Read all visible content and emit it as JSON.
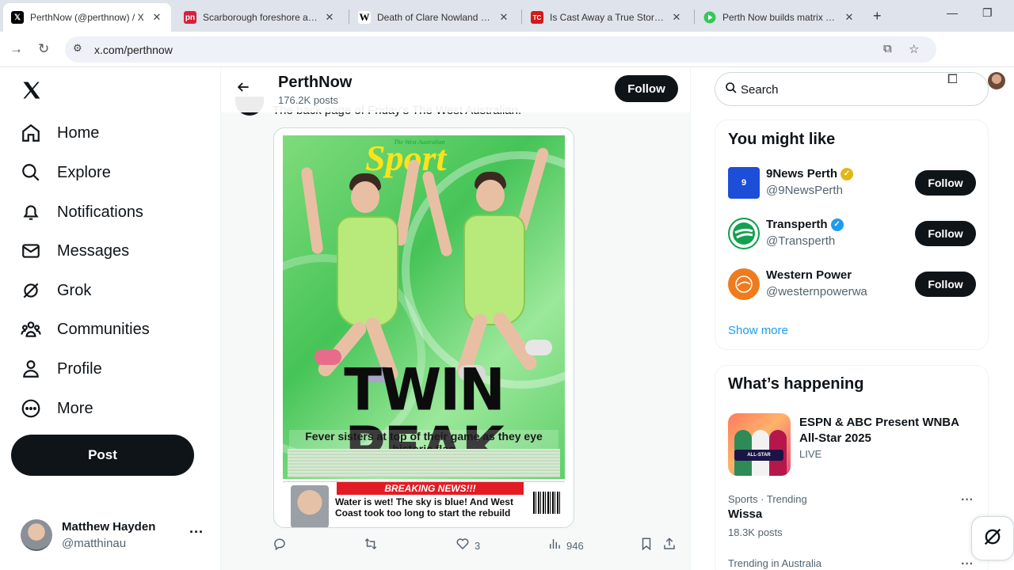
{
  "browser": {
    "tabs": [
      {
        "title": "PerthNow (@perthnow) / X",
        "icon": "x-logo-icon",
        "active": true
      },
      {
        "title": "Scarborough foreshore arrest",
        "icon": "pn-icon",
        "favicon_text": "pn",
        "active": false
      },
      {
        "title": "Death of Clare Nowland - Wikipedia",
        "icon": "wikipedia-icon",
        "favicon_text": "W",
        "active": false
      },
      {
        "title": "Is Cast Away a True Story? Is",
        "icon": "tc-icon",
        "favicon_text": "TC",
        "active": false
      },
      {
        "title": "Perth Now builds matrix with",
        "icon": "play-icon",
        "active": false
      }
    ],
    "url": "x.com/perthnow"
  },
  "sidebar": {
    "items": [
      {
        "label": "Home",
        "icon": "home-icon"
      },
      {
        "label": "Explore",
        "icon": "search-icon"
      },
      {
        "label": "Notifications",
        "icon": "bell-icon"
      },
      {
        "label": "Messages",
        "icon": "mail-icon"
      },
      {
        "label": "Grok",
        "icon": "grok-icon"
      },
      {
        "label": "Communities",
        "icon": "communities-icon"
      },
      {
        "label": "Profile",
        "icon": "person-icon"
      },
      {
        "label": "More",
        "icon": "more-circle-icon"
      }
    ],
    "post_label": "Post",
    "user": {
      "name": "Matthew Hayden",
      "handle": "@matthinau"
    }
  },
  "profile_header": {
    "name": "PerthNow",
    "posts": "176.2K posts",
    "follow_label": "Follow"
  },
  "tweet": {
    "text": "The back page of Friday's The West Australian.",
    "cover": {
      "paper": "The West Australian",
      "section": "Sport",
      "headline": "TWIN PEAK",
      "subhead": "Fever sisters at top of their game as they eye historic flag",
      "breaking_banner": "BREAKING NEWS!!!",
      "breaking_text": "Water is wet! The sky is blue! And West Coast took too long to start the rebuild"
    },
    "actions": {
      "reply": "",
      "retweet": "",
      "likes": "3",
      "views": "946"
    }
  },
  "right": {
    "search_placeholder": "Search",
    "you_might_like": {
      "title": "You might like",
      "accounts": [
        {
          "name": "9News Perth",
          "handle": "@9NewsPerth",
          "badge": "gold",
          "follow": "Follow"
        },
        {
          "name": "Transperth",
          "handle": "@Transperth",
          "badge": "blue",
          "follow": "Follow"
        },
        {
          "name": "Western Power",
          "handle": "@westernpowerwa",
          "badge": "",
          "follow": "Follow"
        }
      ],
      "show_more": "Show more"
    },
    "whats_happening": {
      "title": "What’s happening",
      "featured": {
        "title": "ESPN & ABC Present WNBA All-Star 2025",
        "status": "LIVE"
      },
      "trends": [
        {
          "meta": "Sports · Trending",
          "name": "Wissa",
          "posts": "18.3K posts"
        },
        {
          "meta": "Trending in Australia",
          "name": "",
          "posts": ""
        }
      ]
    }
  },
  "colors": {
    "accent": "#1d9bf0",
    "black": "#0f1419",
    "secondary_text": "#536471",
    "gold_badge": "#e2b719"
  }
}
